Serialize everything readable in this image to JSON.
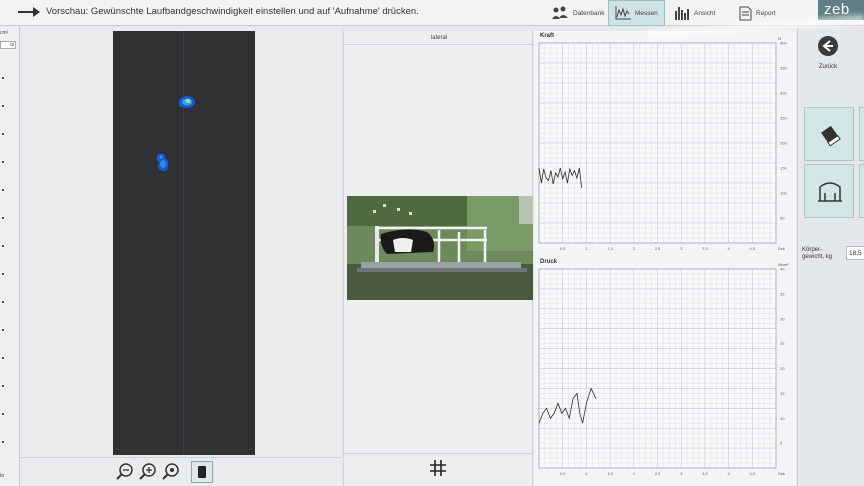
{
  "topbar": {
    "message": "Vorschau: Gewünschte Laufbandgeschwindigkeit einstellen und auf 'Aufnahme' drücken.",
    "buttons": [
      {
        "label": "Datenbank",
        "icon": "people-icon"
      },
      {
        "label": "Messen",
        "icon": "measure-icon",
        "active": true
      },
      {
        "label": "Ansicht",
        "icon": "bars-icon"
      },
      {
        "label": "Report",
        "icon": "document-icon"
      }
    ],
    "brand": "zeb"
  },
  "left_strip": {
    "unit_top": "cm²",
    "unit_box": "iz",
    "bottom_label": "to"
  },
  "camera": {
    "header": "lateral"
  },
  "charts": {
    "kraft_title": "Kraft",
    "druck_title": "Druck",
    "x_unit": "Sek",
    "y_unit_kraft": "N",
    "y_unit_druck": "N/cm²"
  },
  "chart_data": [
    {
      "type": "line",
      "title": "Kraft",
      "x": [
        0.0,
        0.05,
        0.1,
        0.15,
        0.2,
        0.25,
        0.3,
        0.35,
        0.4,
        0.45,
        0.5,
        0.55,
        0.6,
        0.65,
        0.7,
        0.75,
        0.8,
        0.85,
        0.9
      ],
      "y": [
        150,
        120,
        148,
        130,
        125,
        145,
        118,
        140,
        132,
        150,
        128,
        142,
        120,
        148,
        135,
        145,
        130,
        150,
        110
      ],
      "xlim": [
        0,
        5
      ],
      "ylim": [
        0,
        400
      ],
      "xunit": "Sek",
      "yunit": "N",
      "grid": true
    },
    {
      "type": "line",
      "title": "Druck",
      "x": [
        0.0,
        0.08,
        0.16,
        0.24,
        0.32,
        0.4,
        0.48,
        0.56,
        0.64,
        0.72,
        0.8,
        0.86,
        0.92,
        1.0,
        1.1,
        1.2
      ],
      "y": [
        9,
        11,
        12,
        10,
        11,
        13,
        11,
        12,
        10,
        14,
        15,
        11,
        9,
        13,
        16,
        14
      ],
      "xlim": [
        0,
        5
      ],
      "ylim": [
        0,
        40
      ],
      "xunit": "Sek",
      "yunit": "N/cm²",
      "grid": true
    }
  ],
  "right_panel": {
    "back_label": "Zurück",
    "tile1_icon": "eraser-icon",
    "tile2_icon": "gait-icon",
    "weight_label_1": "Körper-",
    "weight_label_2": "gewicht, kg",
    "weight_value": "18,5"
  }
}
